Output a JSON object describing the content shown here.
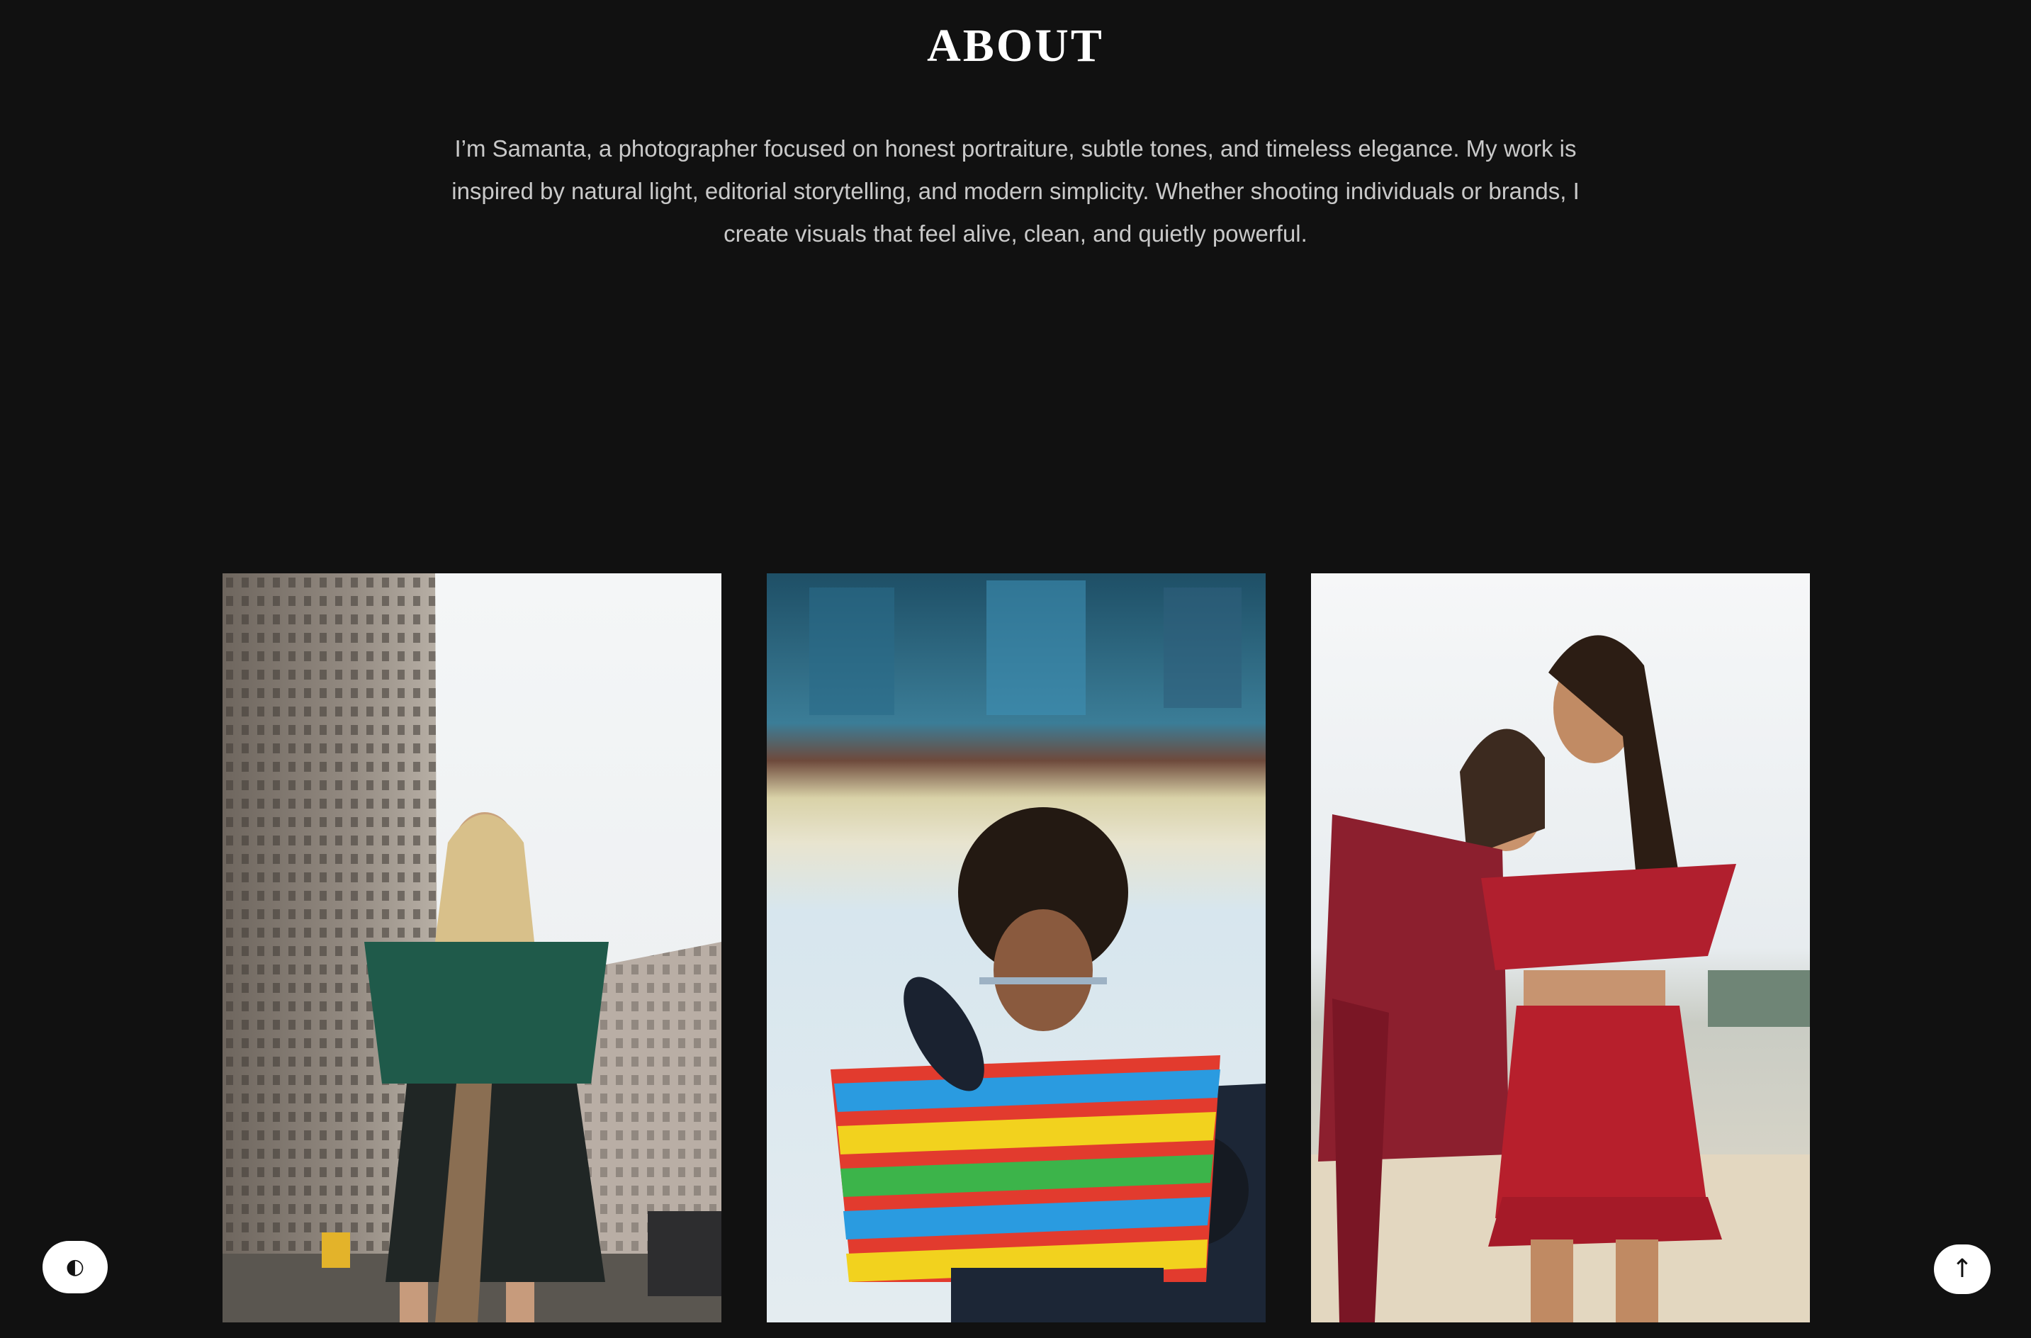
{
  "about": {
    "title": "ABOUT",
    "text": "I’m Samanta, a photographer focused on honest portraiture, subtle tones, and timeless elegance. My work is inspired by natural light, editorial storytelling, and modern simplicity. Whether shooting individuals or brands, I create visuals that feel alive, clean, and quietly powerful."
  },
  "gallery": {
    "photos": [
      {
        "icon": "photo-street-woman-green-jacket"
      },
      {
        "icon": "photo-woman-rainbow-shirt"
      },
      {
        "icon": "photo-two-women-red-dresses"
      }
    ]
  },
  "controls": {
    "theme_toggle_glyph": "◐",
    "back_to_top_glyph": "↑"
  },
  "colors": {
    "background": "#111111",
    "title": "#ffffff",
    "text": "#c9c9c9",
    "button": "#ffffff"
  }
}
